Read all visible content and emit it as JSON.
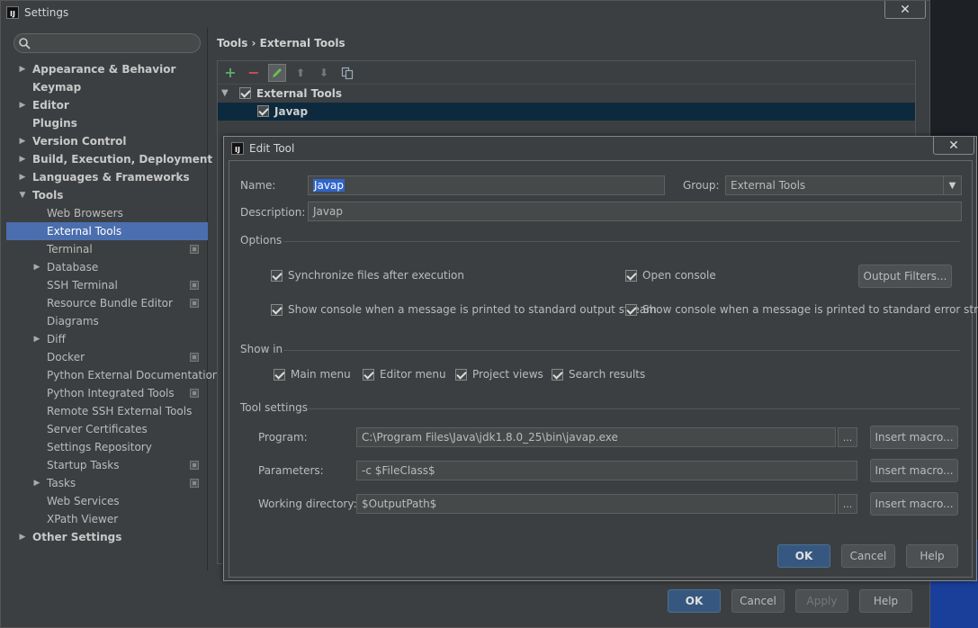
{
  "settings": {
    "title": "Settings",
    "close": "✕",
    "search": {
      "value": "",
      "placeholder": ""
    },
    "tree": [
      {
        "label": "Appearance & Behavior",
        "level": 0,
        "arrow": "▶"
      },
      {
        "label": "Keymap",
        "level": 0,
        "arrow": ""
      },
      {
        "label": "Editor",
        "level": 0,
        "arrow": "▶"
      },
      {
        "label": "Plugins",
        "level": 0,
        "arrow": ""
      },
      {
        "label": "Version Control",
        "level": 0,
        "arrow": "▶"
      },
      {
        "label": "Build, Execution, Deployment",
        "level": 0,
        "arrow": "▶"
      },
      {
        "label": "Languages & Frameworks",
        "level": 0,
        "arrow": "▶"
      },
      {
        "label": "Tools",
        "level": 0,
        "arrow": "▼"
      },
      {
        "label": "Web Browsers",
        "level": 1,
        "arrow": ""
      },
      {
        "label": "External Tools",
        "level": 1,
        "arrow": "",
        "selected": true
      },
      {
        "label": "Terminal",
        "level": 1,
        "arrow": "",
        "project": true
      },
      {
        "label": "Database",
        "level": 1,
        "arrow": "▶"
      },
      {
        "label": "SSH Terminal",
        "level": 1,
        "arrow": "",
        "project": true
      },
      {
        "label": "Resource Bundle Editor",
        "level": 1,
        "arrow": "",
        "project": true
      },
      {
        "label": "Diagrams",
        "level": 1,
        "arrow": ""
      },
      {
        "label": "Diff",
        "level": 1,
        "arrow": "▶"
      },
      {
        "label": "Docker",
        "level": 1,
        "arrow": "",
        "project": true
      },
      {
        "label": "Python External Documentation",
        "level": 1,
        "arrow": ""
      },
      {
        "label": "Python Integrated Tools",
        "level": 1,
        "arrow": "",
        "project": true
      },
      {
        "label": "Remote SSH External Tools",
        "level": 1,
        "arrow": ""
      },
      {
        "label": "Server Certificates",
        "level": 1,
        "arrow": ""
      },
      {
        "label": "Settings Repository",
        "level": 1,
        "arrow": ""
      },
      {
        "label": "Startup Tasks",
        "level": 1,
        "arrow": "",
        "project": true
      },
      {
        "label": "Tasks",
        "level": 1,
        "arrow": "▶",
        "project": true
      },
      {
        "label": "Web Services",
        "level": 1,
        "arrow": ""
      },
      {
        "label": "XPath Viewer",
        "level": 1,
        "arrow": ""
      },
      {
        "label": "Other Settings",
        "level": 0,
        "arrow": "▶"
      }
    ],
    "breadcrumb": "Tools › External Tools",
    "toolbar": {
      "add": "+",
      "remove": "−",
      "up": "⬆",
      "down": "⬇"
    },
    "table": {
      "group_arrow": "▼",
      "group_label": "External Tools",
      "item_label": "Javap"
    },
    "buttons": {
      "ok": "OK",
      "cancel": "Cancel",
      "apply": "Apply",
      "help": "Help"
    }
  },
  "dialog": {
    "title": "Edit Tool",
    "close": "✕",
    "name_label": "Name:",
    "name_value": "Javap",
    "group_label": "Group:",
    "group_value": "External Tools",
    "description_label": "Description:",
    "description_value": "Javap",
    "options_title": "Options",
    "options": {
      "sync_files": "Synchronize files after execution",
      "open_console": "Open console",
      "show_console_stdout": "Show console when a message is printed to standard output stream",
      "show_console_stderr": "Show console when a message is printed to standard error stream"
    },
    "output_filters": "Output Filters...",
    "show_in_title": "Show in",
    "show_in": {
      "main_menu": "Main menu",
      "editor_menu": "Editor menu",
      "project_views": "Project views",
      "search_results": "Search results"
    },
    "tool_settings_title": "Tool settings",
    "program_label": "Program:",
    "program_value": "C:\\Program Files\\Java\\jdk1.8.0_25\\bin\\javap.exe",
    "parameters_label": "Parameters:",
    "parameters_value": "-c $FileClass$",
    "working_dir_label": "Working directory:",
    "working_dir_value": "$OutputPath$",
    "browse": "...",
    "insert_macro": "Insert macro...",
    "buttons": {
      "ok": "OK",
      "cancel": "Cancel",
      "help": "Help"
    }
  },
  "colors": {
    "background": "#3c3f41",
    "selection": "#4b6eaf",
    "primary_button": "#365880",
    "add_icon": "#59a869",
    "remove_icon": "#c75450"
  }
}
